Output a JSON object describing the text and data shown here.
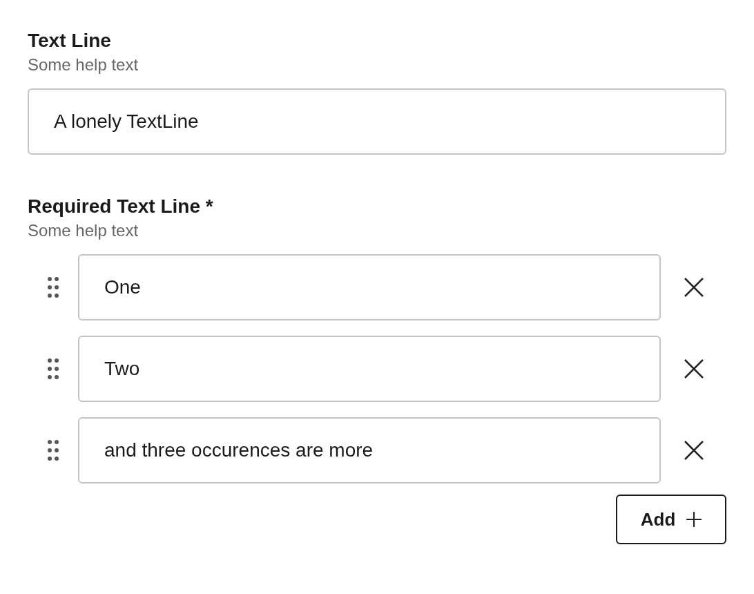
{
  "fields": [
    {
      "kind": "single",
      "label": "Text Line",
      "help": "Some help text",
      "value": "A lonely TextLine"
    },
    {
      "kind": "list",
      "label": "Required Text Line *",
      "help": "Some help text",
      "items": [
        {
          "value": "One"
        },
        {
          "value": "Two"
        },
        {
          "value": "and three occurences are more"
        }
      ],
      "add_button": "Add"
    }
  ]
}
